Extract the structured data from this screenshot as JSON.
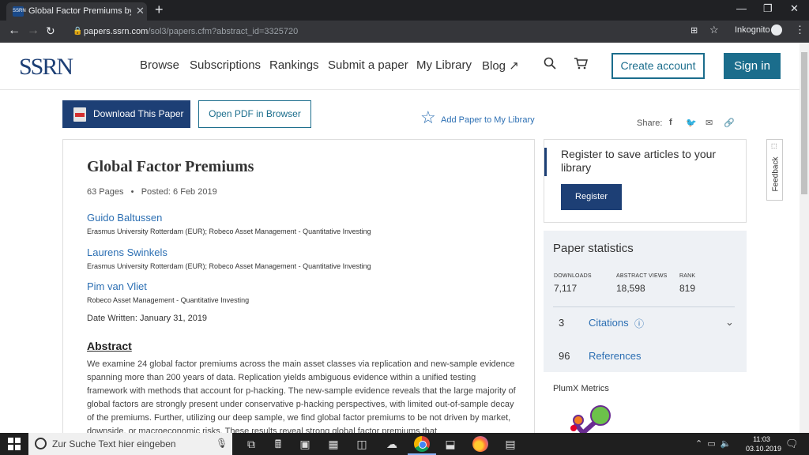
{
  "browser": {
    "tab_title": "Global Factor Premiums by Guido B",
    "tab_favicon": "SSRN",
    "url_host": "papers.ssrn.com",
    "url_path": "/sol3/papers.cfm?abstract_id=3325720",
    "profile_label": "Inkognito"
  },
  "header": {
    "logo": "SSRN",
    "nav": [
      "Browse",
      "Subscriptions",
      "Rankings",
      "Submit a paper",
      "My Library",
      "Blog ↗"
    ],
    "create_account": "Create account",
    "sign_in": "Sign in"
  },
  "actions": {
    "download": "Download This Paper",
    "open_pdf": "Open PDF in Browser",
    "add_library": "Add Paper to My Library",
    "share_label": "Share:"
  },
  "paper": {
    "title": "Global Factor Premiums",
    "pages": "63 Pages",
    "separator": "•",
    "posted": "Posted: 6 Feb 2019",
    "authors": [
      {
        "name": "Guido Baltussen",
        "affiliation": "Erasmus University Rotterdam (EUR); Robeco Asset Management - Quantitative Investing"
      },
      {
        "name": "Laurens Swinkels",
        "affiliation": "Erasmus University Rotterdam (EUR); Robeco Asset Management - Quantitative Investing"
      },
      {
        "name": "Pim van Vliet",
        "affiliation": "Robeco Asset Management - Quantitative Investing"
      }
    ],
    "date_written": "Date Written: January 31, 2019",
    "abstract_heading": "Abstract",
    "abstract": "We examine 24 global factor premiums across the main asset classes via replication and new-sample evidence spanning more than 200 years of data. Replication yields ambiguous evidence within a unified testing framework with methods that account for p-hacking. The new-sample evidence reveals that the large majority of global factors are strongly present under conservative p-hacking perspectives, with limited out-of-sample decay of the premiums. Further, utilizing our deep sample, we find global factor premiums to be not driven by market, downside, or macroeconomic risks. These results reveal strong global factor premiums that"
  },
  "register": {
    "title": "Register to save articles to your library",
    "button": "Register"
  },
  "stats": {
    "title": "Paper statistics",
    "downloads_label": "DOWNLOADS",
    "downloads": "7,117",
    "views_label": "ABSTRACT VIEWS",
    "views": "18,598",
    "rank_label": "RANK",
    "rank": "819",
    "citations_count": "3",
    "citations_label": "Citations",
    "references_count": "96",
    "references_label": "References"
  },
  "plumx": "PlumX Metrics",
  "feedback": "Feedback",
  "taskbar": {
    "search_placeholder": "Zur Suche Text hier eingeben",
    "time": "11:03",
    "date": "03.10.2019"
  },
  "colors": {
    "brand_navy": "#1d3f75",
    "brand_teal": "#1b6d8c",
    "link_blue": "#2c6fb3"
  }
}
